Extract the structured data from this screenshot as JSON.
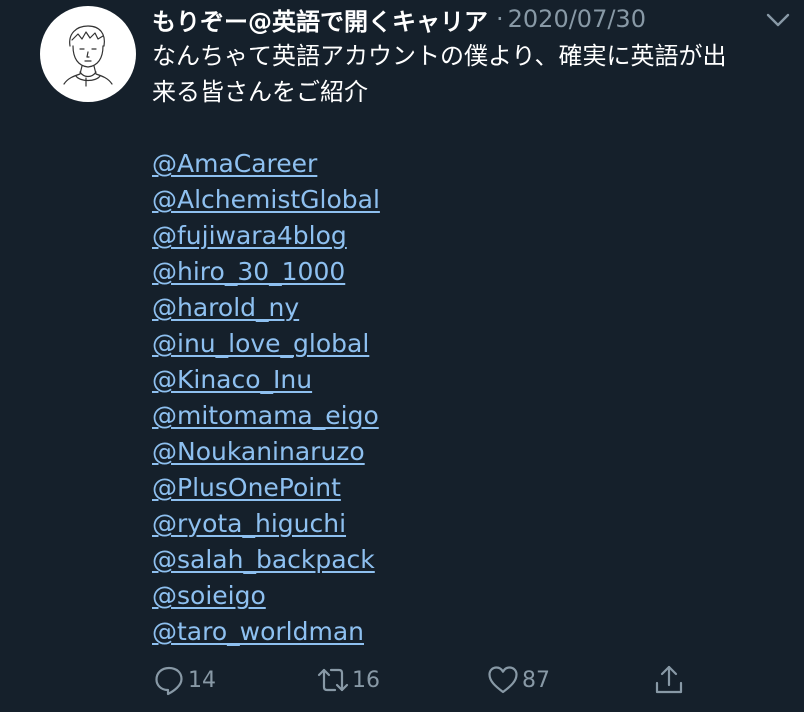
{
  "tweet": {
    "display_name": "もりぞー@英語で開くキャリア",
    "separator": "·",
    "date": "2020/07/30",
    "text_line1": "なんちゃて英語アカウントの僕より、確実に英語が出",
    "text_line2": "来る皆さんをご紹介",
    "mentions": [
      "@AmaCareer",
      "@AlchemistGlobal",
      "@fujiwara4blog",
      "@hiro_30_1000",
      "@harold_ny",
      "@inu_love_global",
      "@Kinaco_Inu",
      "@mitomama_eigo",
      "@Noukaninaruzo",
      "@PlusOnePoint",
      "@ryota_higuchi",
      "@salah_backpack",
      "@soieigo",
      "@taro_worldman"
    ]
  },
  "actions": {
    "reply_count": "14",
    "retweet_count": "16",
    "like_count": "87"
  },
  "icons": {
    "avatar": "avatar-line-drawing",
    "more": "chevron-down-icon",
    "reply": "reply-icon",
    "retweet": "retweet-icon",
    "like": "heart-icon",
    "share": "share-icon"
  },
  "colors": {
    "background": "#15202b",
    "link": "#8ec0f0",
    "muted": "#8899a6",
    "text": "#ffffff"
  }
}
